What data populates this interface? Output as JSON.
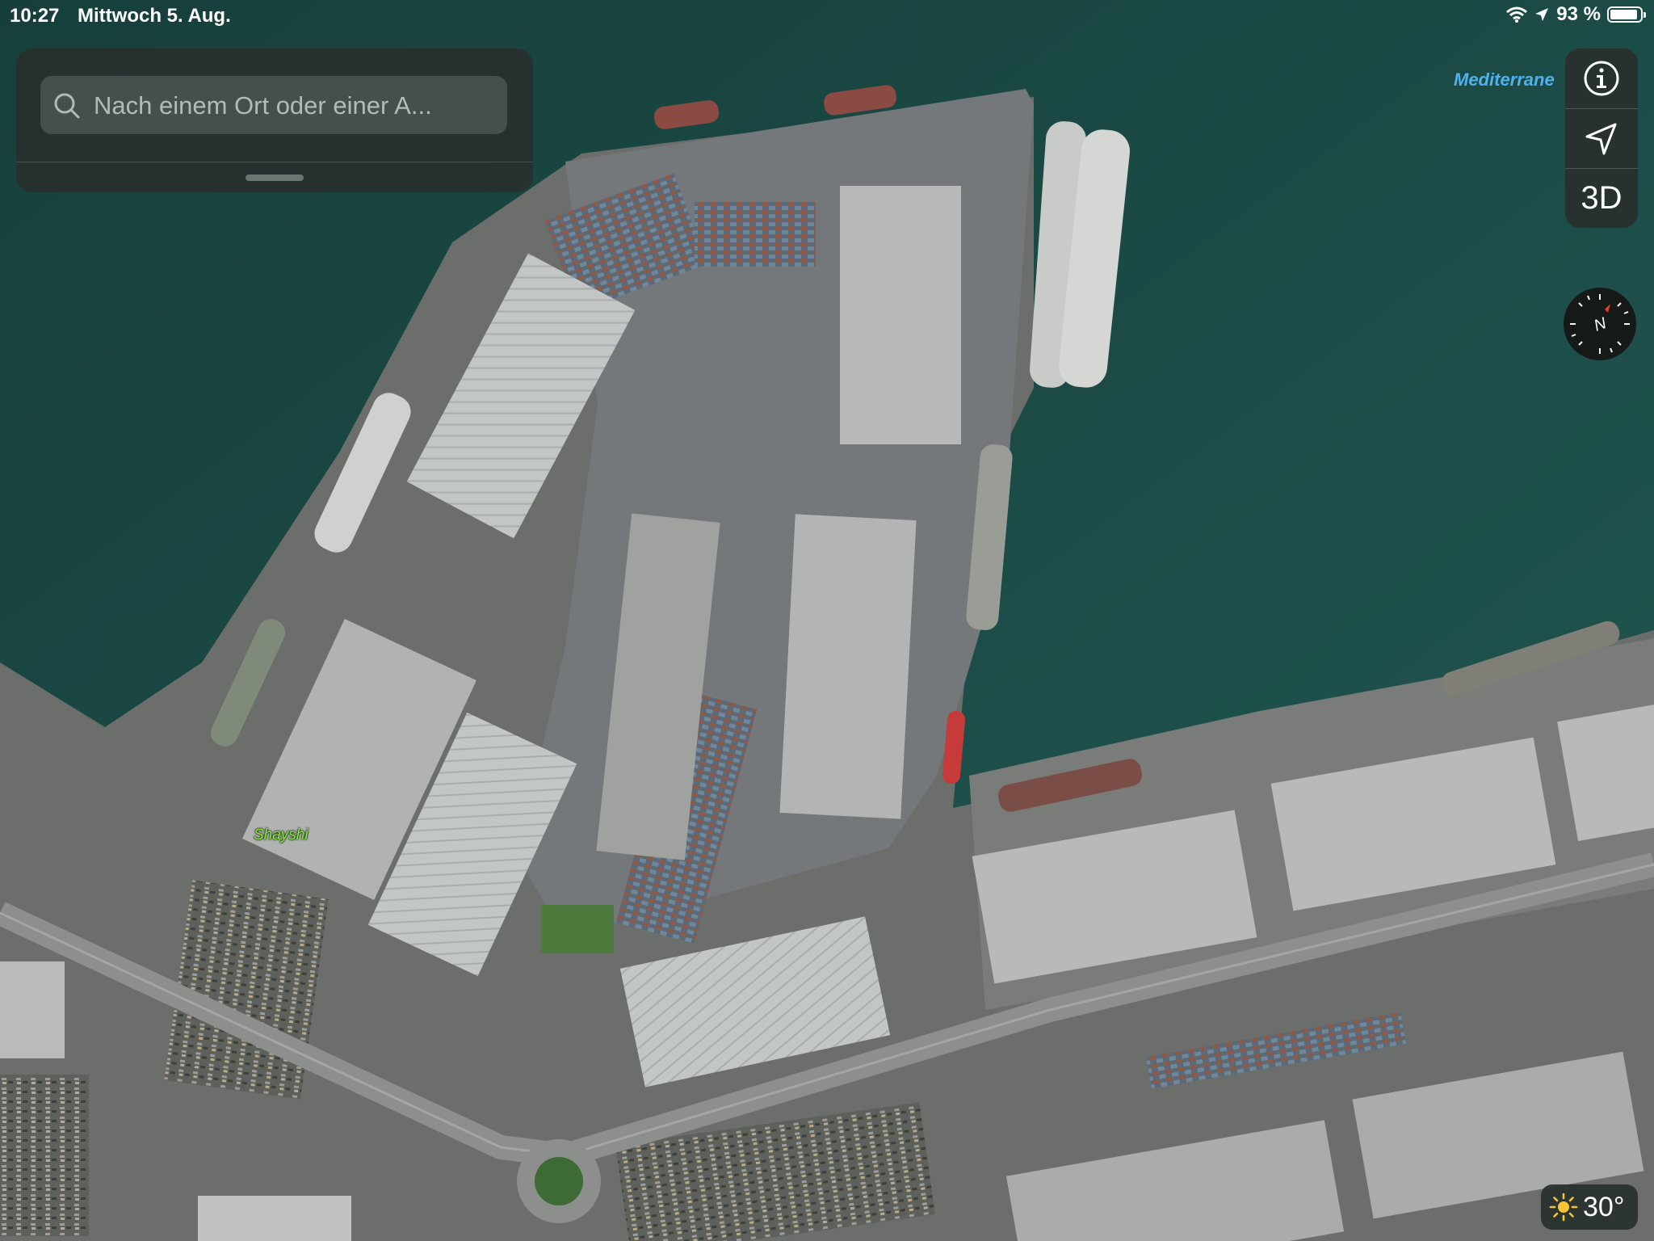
{
  "status_bar": {
    "time": "10:27",
    "date": "Mittwoch 5. Aug.",
    "battery_text": "93 %",
    "battery_level": 0.93
  },
  "search": {
    "placeholder": "Nach einem Ort oder einer A..."
  },
  "controls": {
    "info_icon": "info-icon",
    "location_icon": "location-arrow-icon",
    "view_3d_label": "3D",
    "compass_label": "N"
  },
  "map_labels": {
    "sea": "Mediterrane",
    "place": "Shayshi"
  },
  "weather": {
    "temperature": "30°",
    "icon": "sun-icon"
  },
  "colors": {
    "sea": "#1c4b46",
    "land": "#6f7370",
    "warehouse_roof": "#b9bcba",
    "sea_label": "#4fb1ee",
    "place_label": "#7ff22a",
    "compass_needle": "#e8392b"
  }
}
